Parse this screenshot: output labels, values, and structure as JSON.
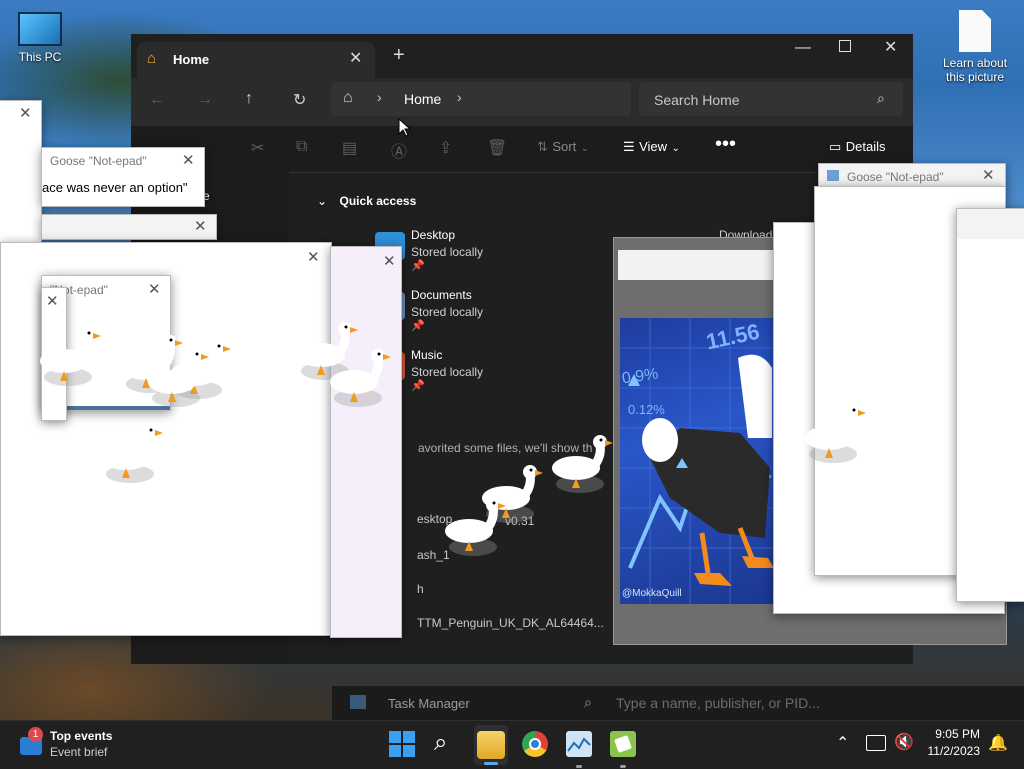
{
  "desktop": {
    "this_pc": "This PC",
    "learn_picture": "Learn about this picture"
  },
  "explorer": {
    "tab_title": "Home",
    "breadcrumb": "Home",
    "search_placeholder": "Search Home",
    "toolbar": {
      "sort": "Sort",
      "view": "View",
      "details": "Details"
    },
    "quick_access": "Quick access",
    "sidebar_partial": "me",
    "items": [
      {
        "name": "Desktop",
        "sub": "Stored locally"
      },
      {
        "name": "Documents",
        "sub": "Stored locally"
      },
      {
        "name": "Music",
        "sub": "Stored locally"
      }
    ],
    "partial_downloads": "Download",
    "favorites_partial": "avorited some files, we'll show th",
    "recent": [
      "esktop",
      "v0.31",
      "ash_1",
      "h",
      "TTM_Penguin_UK_DK_AL64464..."
    ]
  },
  "goose_windows": {
    "title_a": "Goose \"Not-epad\"",
    "title_b": "Goose \"Not-epad\"",
    "title_c": "\"Not-epad\"",
    "note_text": "ace was never an option\""
  },
  "meme": {
    "watermark": "@MokkaQuill",
    "ticker_1": "11.56",
    "ticker_2": "0.9%",
    "ticker_3": "0.12%"
  },
  "task_manager": {
    "title": "Task Manager",
    "search_placeholder": "Type a name, publisher, or PID..."
  },
  "taskbar": {
    "widget_title": "Top events",
    "widget_sub": "Event brief",
    "widget_badge": "1",
    "time": "9:05 PM",
    "date": "11/2/2023"
  }
}
